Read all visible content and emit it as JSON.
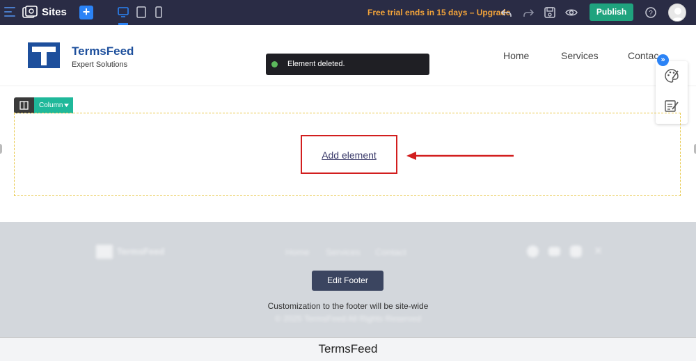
{
  "toolbar": {
    "app_title": "Sites",
    "add_label": "+",
    "trial_text": "Free trial ends in 15 days – Upgrade",
    "publish_label": "Publish",
    "icons": [
      "menu-icon",
      "sites-icon",
      "desktop-icon",
      "tablet-icon",
      "mobile-icon",
      "undo-icon",
      "redo-icon",
      "save-icon",
      "preview-icon",
      "help-icon",
      "avatar"
    ]
  },
  "site_header": {
    "logo_letter": "T",
    "brand_name": "TermsFeed",
    "tagline": "Expert Solutions",
    "nav": [
      "Home",
      "Services",
      "Contac"
    ]
  },
  "toast": {
    "message": "Element deleted."
  },
  "side_panel": {
    "toggle_label": "»",
    "icons": [
      "palette-icon",
      "edit-note-icon"
    ]
  },
  "column": {
    "badge_label": "Column",
    "add_element_label": "Add element"
  },
  "footer": {
    "brand_name": "TermsFeed",
    "nav": [
      "Home",
      "Services",
      "Contact"
    ],
    "edit_label": "Edit Footer",
    "note": "Customization to the footer will be site-wide",
    "copyright": "© 2025 TermsFeed All Rights Reserved"
  },
  "caption": "TermsFeed",
  "colors": {
    "toolbar_bg": "#2a2c45",
    "accent_blue": "#2b83f6",
    "publish_green": "#1fa37e",
    "trial_orange": "#f2a33a",
    "brand_blue": "#1d4f9c",
    "highlight_red": "#d21e1e",
    "footer_bg": "#d3d7dc"
  }
}
